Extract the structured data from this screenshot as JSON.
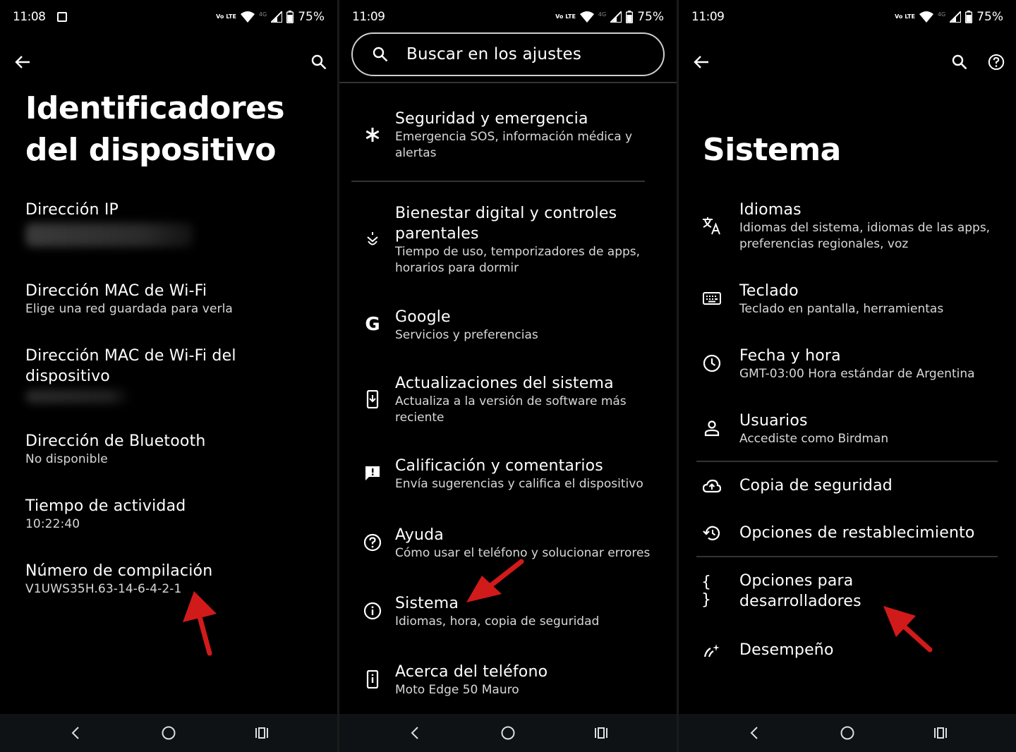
{
  "colors": {
    "background": "#000000",
    "text": "#ffffff",
    "subtext": "#d8d8d8",
    "navbar": "#0f1215",
    "arrow": "#d11a1a"
  },
  "panel1": {
    "status": {
      "time": "11:08",
      "volte": "Vo LTE",
      "net": "4G",
      "battery": "75%"
    },
    "title_line1": "Identificadores",
    "title_line2": "del dispositivo",
    "items": [
      {
        "title": "Dirección IP"
      },
      {
        "title": "Dirección MAC de Wi-Fi",
        "subtitle": "Elige una red guardada para verla"
      },
      {
        "title": "Dirección MAC de Wi-Fi del dispositivo"
      },
      {
        "title": "Dirección de Bluetooth",
        "subtitle": "No disponible"
      },
      {
        "title": "Tiempo de actividad",
        "subtitle": "10:22:40"
      },
      {
        "title": "Número de compilación",
        "subtitle": "V1UWS35H.63-14-6-4-2-1"
      }
    ]
  },
  "panel2": {
    "status": {
      "time": "11:09",
      "volte": "Vo LTE",
      "net": "4G",
      "battery": "75%"
    },
    "search_placeholder": "Buscar en los ajustes",
    "items": [
      {
        "title": "Seguridad y emergencia",
        "subtitle": "Emergencia SOS, información médica y alertas",
        "icon": "asterisk-icon"
      },
      {
        "title": "Bienestar digital y controles parentales",
        "subtitle": "Tiempo de uso, temporizadores de apps, horarios para dormir",
        "icon": "wellbeing-icon"
      },
      {
        "title": "Google",
        "subtitle": "Servicios y preferencias",
        "icon": "google-icon"
      },
      {
        "title": "Actualizaciones del sistema",
        "subtitle": "Actualiza a la versión de software más reciente",
        "icon": "system-update-icon"
      },
      {
        "title": "Calificación y comentarios",
        "subtitle": "Envía sugerencias y califica el dispositivo",
        "icon": "feedback-icon"
      },
      {
        "title": "Ayuda",
        "subtitle": "Cómo usar el teléfono y solucionar errores",
        "icon": "help-icon"
      },
      {
        "title": "Sistema",
        "subtitle": "Idiomas, hora, copia de seguridad",
        "icon": "info-icon"
      },
      {
        "title": "Acerca del teléfono",
        "subtitle": "Moto Edge 50 Mauro",
        "icon": "phone-info-icon"
      }
    ]
  },
  "panel3": {
    "status": {
      "time": "11:09",
      "volte": "Vo LTE",
      "net": "4G",
      "battery": "75%"
    },
    "title": "Sistema",
    "items": [
      {
        "title": "Idiomas",
        "subtitle": "Idiomas del sistema, idiomas de las apps, preferencias regionales, voz",
        "icon": "translate-icon"
      },
      {
        "title": "Teclado",
        "subtitle": "Teclado en pantalla, herramientas",
        "icon": "keyboard-icon"
      },
      {
        "title": "Fecha y hora",
        "subtitle": "GMT-03:00 Hora estándar de Argentina",
        "icon": "clock-icon"
      },
      {
        "title": "Usuarios",
        "subtitle": "Accediste como Birdman",
        "icon": "person-icon"
      },
      {
        "title": "Copia de seguridad",
        "icon": "cloud-backup-icon"
      },
      {
        "title": "Opciones de restablecimiento",
        "icon": "restore-icon"
      },
      {
        "title": "Opciones para desarrolladores",
        "icon": "braces-icon"
      },
      {
        "title": "Desempeño",
        "icon": "performance-icon"
      }
    ]
  }
}
